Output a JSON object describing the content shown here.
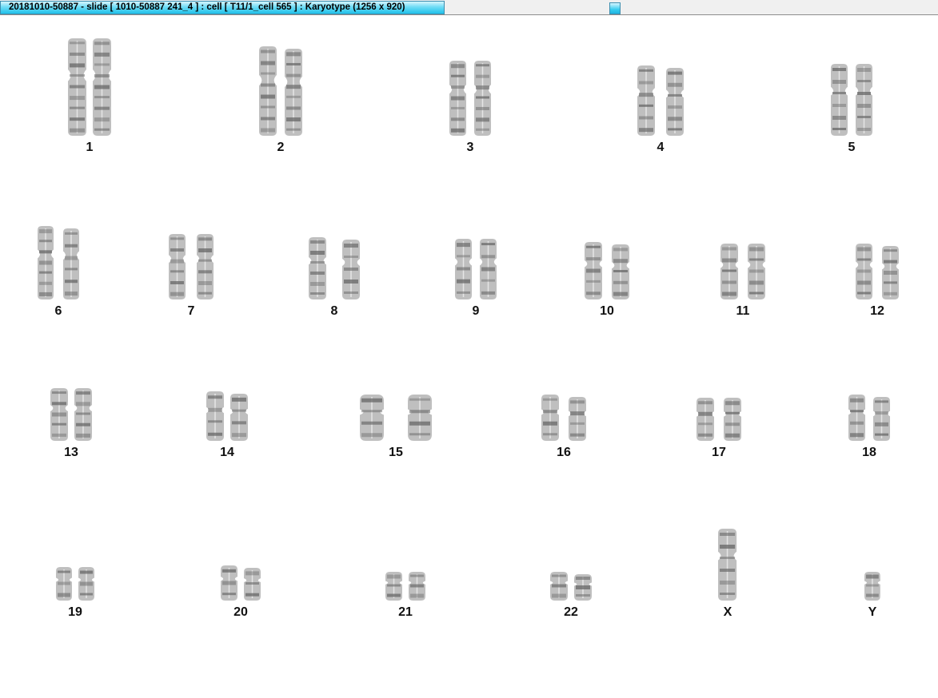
{
  "window": {
    "title": "20181010-50887 - slide [ 1010-50887 241_4 ] : cell [ T11/1_cell 565 ] : Karyotype  (1256 x 920)"
  },
  "karyotype": {
    "labels": [
      "1",
      "2",
      "3",
      "4",
      "5",
      "6",
      "7",
      "8",
      "9",
      "10",
      "11",
      "12",
      "13",
      "14",
      "15",
      "16",
      "17",
      "18",
      "19",
      "20",
      "21",
      "22",
      "X",
      "Y"
    ]
  },
  "colors": {
    "title_gradient_end": "#1fc1ea",
    "chromatin": "#6a6a6a"
  }
}
